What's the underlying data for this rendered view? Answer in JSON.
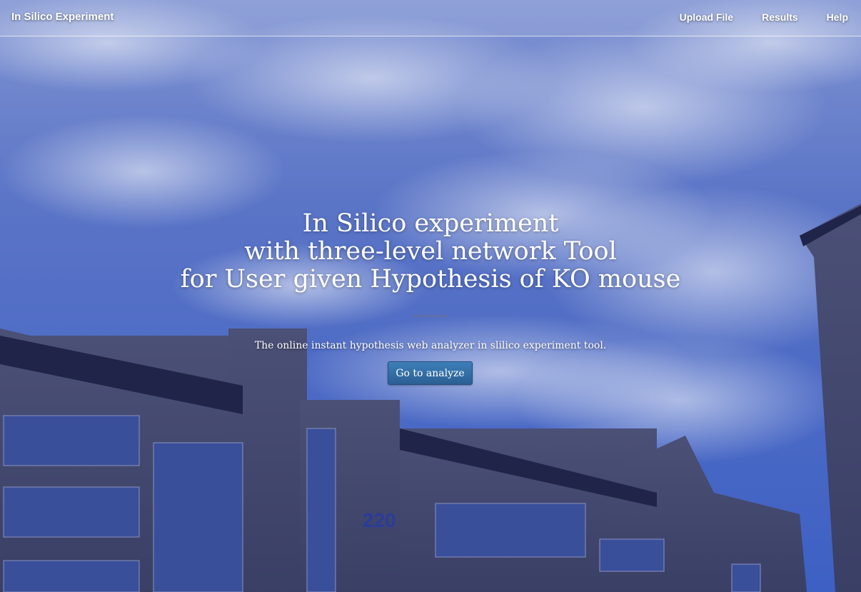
{
  "navbar": {
    "brand": "In Silico Experiment",
    "links": [
      "Upload File",
      "Results",
      "Help"
    ]
  },
  "hero": {
    "title_lines": [
      "In Silico experiment",
      "with three-level network Tool",
      "for User given Hypothesis of KO mouse"
    ],
    "subtitle": "The online instant hypothesis web analyzer in slilico experiment tool.",
    "cta_label": "Go to analyze"
  },
  "background": {
    "building_number": "220"
  },
  "colors": {
    "sky_top": "#5c77c9",
    "sky_bottom": "#3f62c3",
    "building": "#4a4f73",
    "button": "#2f6ca6",
    "divider": "#5f6fa8"
  }
}
